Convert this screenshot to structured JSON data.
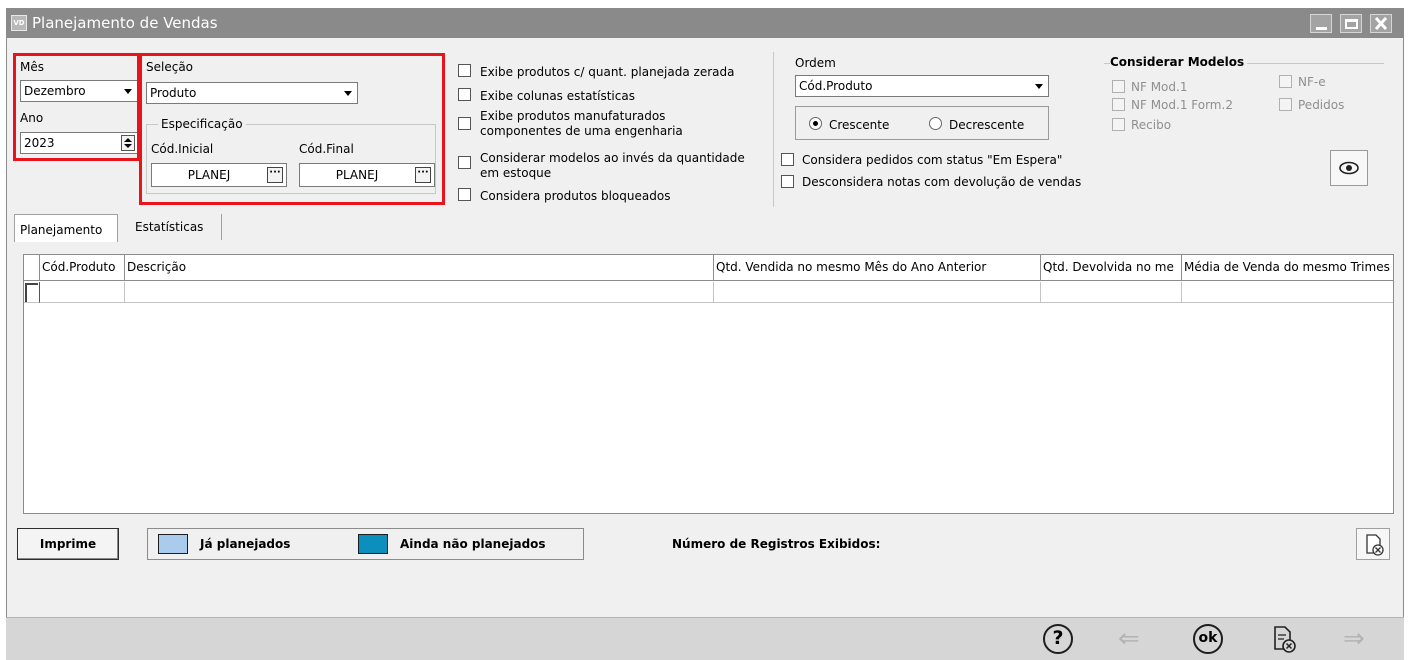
{
  "window": {
    "title": "Planejamento de Vendas",
    "icon_text": "VD"
  },
  "mes": {
    "label": "Mês",
    "value": "Dezembro"
  },
  "ano": {
    "label": "Ano",
    "value": "2023"
  },
  "selecao": {
    "label": "Seleção",
    "value": "Produto"
  },
  "especificacao": {
    "label": "Especificação",
    "inicial_label": "Cód.Inicial",
    "inicial_value": "PLANEJ",
    "final_label": "Cód.Final",
    "final_value": "PLANEJ"
  },
  "options": [
    {
      "label": "Exibe produtos c/ quant. planejada zerada",
      "checked": false
    },
    {
      "label": "Exibe colunas estatísticas",
      "checked": false
    },
    {
      "label_line1": "Exibe produtos manufaturados",
      "label_line2": "componentes de uma engenharia",
      "checked": false
    },
    {
      "label_line1": "Considerar modelos ao invés da quantidade",
      "label_line2": "em estoque",
      "checked": false
    },
    {
      "label": "Considera produtos bloqueados",
      "checked": false
    }
  ],
  "ordem": {
    "label": "Ordem",
    "value": "Cód.Produto",
    "crescente": "Crescente",
    "decrescente": "Decrescente",
    "selected": "Crescente"
  },
  "pedidos_options": [
    {
      "label": "Considera pedidos com status \"Em Espera\"",
      "checked": false
    },
    {
      "label": "Desconsidera notas com devolução de vendas",
      "checked": false
    }
  ],
  "modelos": {
    "title": "Considerar Modelos",
    "items": {
      "nf_mod1": "NF Mod.1",
      "nfe": "NF-e",
      "nf_mod1_form2": "NF Mod.1 Form.2",
      "pedidos": "Pedidos",
      "recibo": "Recibo"
    }
  },
  "tabs": {
    "planejamento": "Planejamento",
    "estatisticas": "Estatísticas",
    "active": "Planejamento"
  },
  "table": {
    "columns": [
      "Cód.Produto",
      "Descrição",
      "Qtd. Vendida no mesmo Mês do Ano Anterior",
      "Qtd. Devolvida no me",
      "Média de Venda do mesmo Trimes"
    ],
    "rows": []
  },
  "bottom": {
    "imprime": "Imprime",
    "legend_planejados": "Já planejados",
    "legend_nao_planejados": "Ainda não planejados",
    "registros_label": "Número de Registros Exibidos:",
    "registros_value": ""
  },
  "footer": {
    "help": "?",
    "ok": "ok"
  },
  "colors": {
    "highlight_red": "#e8131b",
    "planejados": "#a9cbec",
    "nao_planejados": "#0d8fbd",
    "titlebar": "#8a8a8a"
  }
}
